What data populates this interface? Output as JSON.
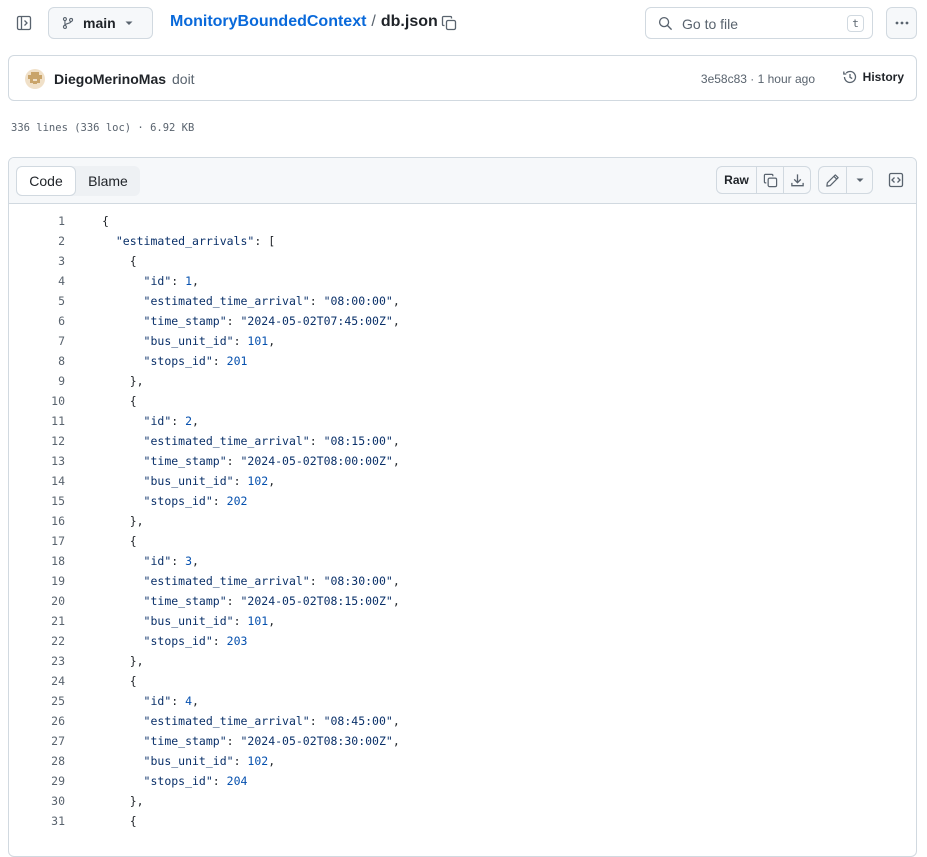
{
  "topbar": {
    "branch": "main",
    "repo": "MonitoryBoundedContext",
    "separator": "/",
    "file": "db.json",
    "search_placeholder": "Go to file",
    "search_shortcut": "t"
  },
  "commit": {
    "author": "DiegoMerinoMas",
    "message": "doit",
    "meta": "3e58c83 · 1 hour ago",
    "history_label": "History"
  },
  "file_info": "336 lines (336 loc) · 6.92 KB",
  "file_header": {
    "tabs": [
      {
        "label": "Code"
      },
      {
        "label": "Blame"
      }
    ],
    "raw_label": "Raw"
  },
  "code_lines": [
    {
      "n": "1",
      "text": "{"
    },
    {
      "n": "2",
      "text": "  \"estimated_arrivals\": ["
    },
    {
      "n": "3",
      "text": "    {"
    },
    {
      "n": "4",
      "text": "      \"id\": 1,"
    },
    {
      "n": "5",
      "text": "      \"estimated_time_arrival\": \"08:00:00\","
    },
    {
      "n": "6",
      "text": "      \"time_stamp\": \"2024-05-02T07:45:00Z\","
    },
    {
      "n": "7",
      "text": "      \"bus_unit_id\": 101,"
    },
    {
      "n": "8",
      "text": "      \"stops_id\": 201"
    },
    {
      "n": "9",
      "text": "    },"
    },
    {
      "n": "10",
      "text": "    {"
    },
    {
      "n": "11",
      "text": "      \"id\": 2,"
    },
    {
      "n": "12",
      "text": "      \"estimated_time_arrival\": \"08:15:00\","
    },
    {
      "n": "13",
      "text": "      \"time_stamp\": \"2024-05-02T08:00:00Z\","
    },
    {
      "n": "14",
      "text": "      \"bus_unit_id\": 102,"
    },
    {
      "n": "15",
      "text": "      \"stops_id\": 202"
    },
    {
      "n": "16",
      "text": "    },"
    },
    {
      "n": "17",
      "text": "    {"
    },
    {
      "n": "18",
      "text": "      \"id\": 3,"
    },
    {
      "n": "19",
      "text": "      \"estimated_time_arrival\": \"08:30:00\","
    },
    {
      "n": "20",
      "text": "      \"time_stamp\": \"2024-05-02T08:15:00Z\","
    },
    {
      "n": "21",
      "text": "      \"bus_unit_id\": 101,"
    },
    {
      "n": "22",
      "text": "      \"stops_id\": 203"
    },
    {
      "n": "23",
      "text": "    },"
    },
    {
      "n": "24",
      "text": "    {"
    },
    {
      "n": "25",
      "text": "      \"id\": 4,"
    },
    {
      "n": "26",
      "text": "      \"estimated_time_arrival\": \"08:45:00\","
    },
    {
      "n": "27",
      "text": "      \"time_stamp\": \"2024-05-02T08:30:00Z\","
    },
    {
      "n": "28",
      "text": "      \"bus_unit_id\": 102,"
    },
    {
      "n": "29",
      "text": "      \"stops_id\": 204"
    },
    {
      "n": "30",
      "text": "    },"
    },
    {
      "n": "31",
      "text": "    {"
    }
  ],
  "colors": {
    "link": "#0969da",
    "string": "#0a3069",
    "number": "#0550ae",
    "muted": "#59636e"
  }
}
